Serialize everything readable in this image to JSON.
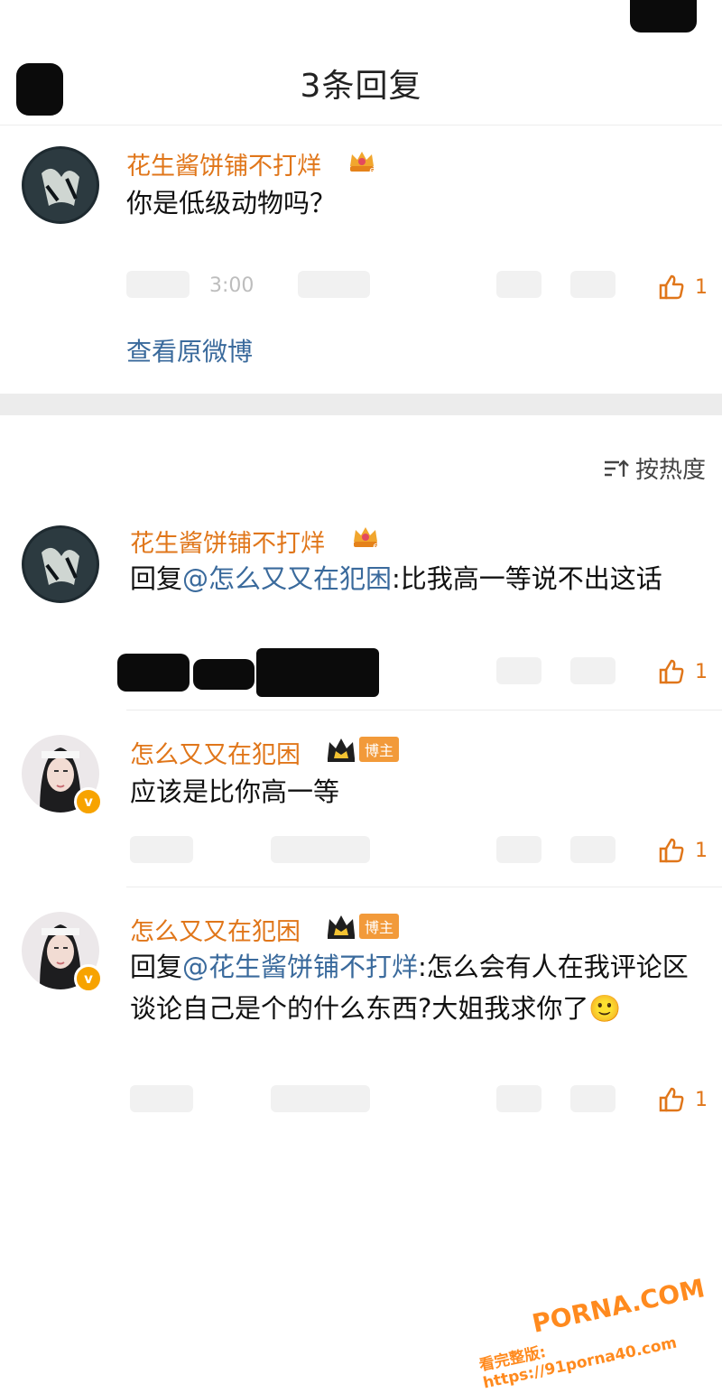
{
  "header": {
    "title": "3条回复"
  },
  "root": {
    "username": "花生酱饼铺不打烊",
    "text": "你是低级动物吗？",
    "time_fragment": "3:00",
    "likes": "1",
    "view_original": "查看原微博"
  },
  "sort": {
    "label": "按热度"
  },
  "replies": [
    {
      "username": "花生酱饼铺不打烊",
      "prefix": "回复",
      "mention": "@怎么又又在犯困",
      "text": ":比我高一等说不出这话",
      "likes": "1"
    },
    {
      "username": "怎么又又在犯困",
      "badge": "博主",
      "text": "应该是比你高一等",
      "likes": "1"
    },
    {
      "username": "怎么又又在犯困",
      "badge": "博主",
      "prefix": "回复",
      "mention": "@花生酱饼铺不打烊",
      "text": ":怎么会有人在我评论区谈论自己是个的什么东西?大姐我求你了",
      "emoji": "🙂",
      "likes": "1"
    }
  ],
  "watermark": {
    "line1": "PORNA.COM",
    "line2": "看完整版: https://91porna40.com"
  },
  "colors": {
    "username": "#e0761a",
    "link": "#3a6a9c",
    "divider": "#ececec"
  },
  "icons": [
    "back-icon",
    "thumbs-up-icon",
    "sort-icon",
    "crown-badge-icon",
    "verified-v-icon",
    "smile-emoji-icon"
  ]
}
